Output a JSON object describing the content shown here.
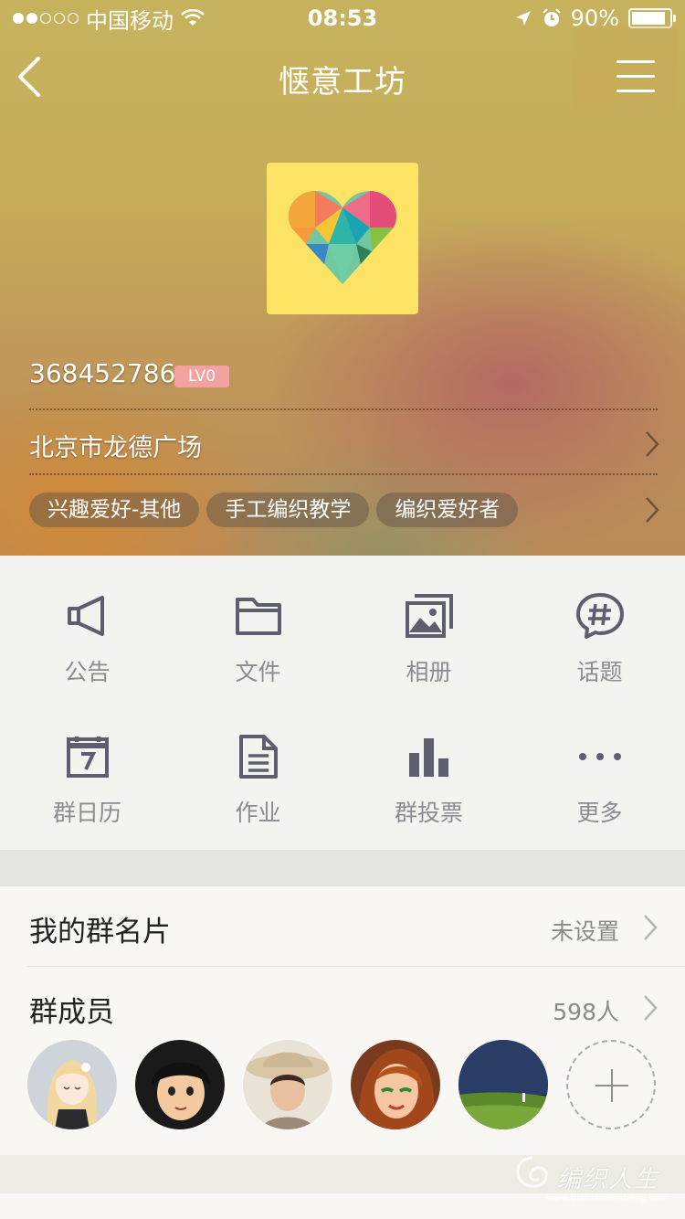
{
  "status_bar": {
    "carrier": "中国移动",
    "time": "08:53",
    "battery": "90%",
    "battery_level": 0.9,
    "signal_dots_filled": 2,
    "signal_dots_total": 5
  },
  "nav": {
    "title": "惬意工坊"
  },
  "group": {
    "id": "368452786",
    "level": "LV0",
    "location": "北京市龙德广场",
    "tags": [
      "兴趣爱好-其他",
      "手工编织教学",
      "编织爱好者"
    ]
  },
  "functions": [
    {
      "label": "公告",
      "icon": "megaphone-icon"
    },
    {
      "label": "文件",
      "icon": "folder-icon"
    },
    {
      "label": "相册",
      "icon": "photo-album-icon"
    },
    {
      "label": "话题",
      "icon": "hashtag-chat-icon"
    },
    {
      "label": "群日历",
      "icon": "calendar-icon"
    },
    {
      "label": "作业",
      "icon": "document-icon"
    },
    {
      "label": "群投票",
      "icon": "bar-chart-icon"
    },
    {
      "label": "更多",
      "icon": "more-icon"
    }
  ],
  "card_row": {
    "title": "我的群名片",
    "value": "未设置"
  },
  "members_row": {
    "title": "群成员",
    "value": "598人"
  },
  "watermark": {
    "text": "编织人生",
    "url": "www.bianzhirensheng.com"
  },
  "colors": {
    "icon": "#5e5e6e",
    "label": "#8b8b92",
    "lv_badge": "#f2a3a1",
    "avatar_bg": "#fde363"
  }
}
